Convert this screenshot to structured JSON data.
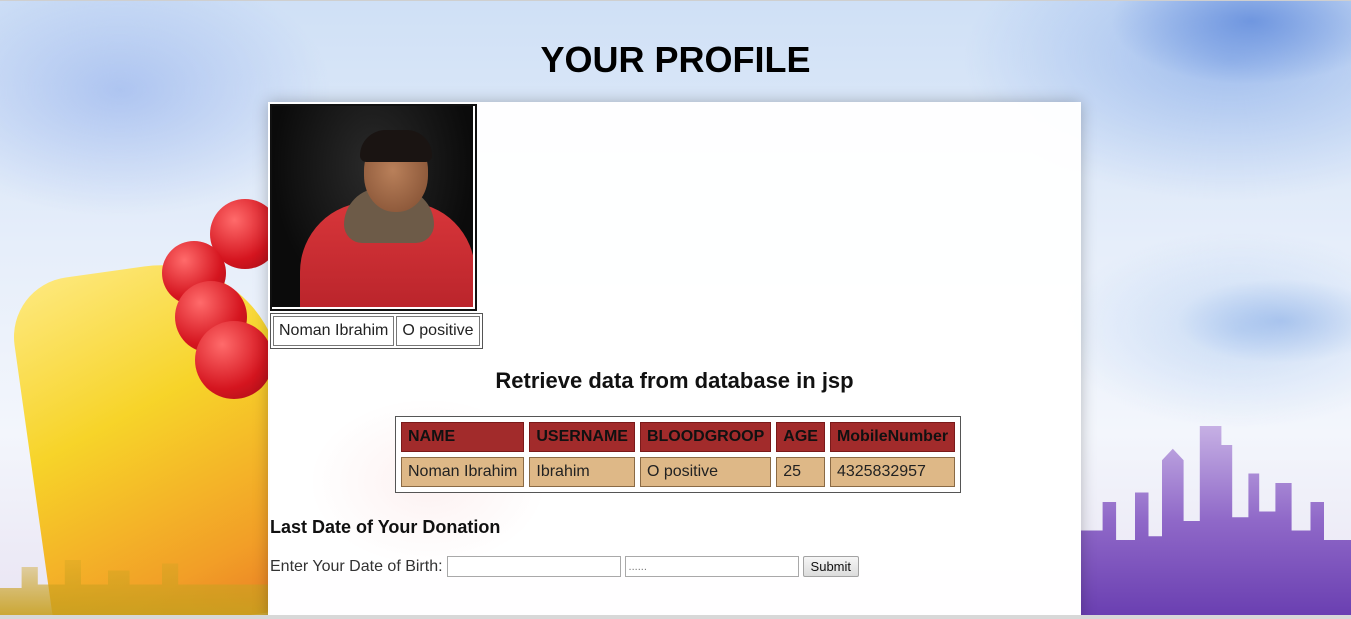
{
  "page": {
    "title": "YOUR PROFILE"
  },
  "profile": {
    "photo_icon": "user-photo",
    "name": "Noman Ibrahim",
    "blood_group": "O positive"
  },
  "records": {
    "heading": "Retrieve data from database in jsp",
    "columns": [
      "NAME",
      "USERNAME",
      "BLOODGROOP",
      "AGE",
      "MobileNumber"
    ],
    "rows": [
      [
        "Noman Ibrahim",
        "Ibrahim",
        "O positive",
        "25",
        "4325832957"
      ]
    ]
  },
  "donation": {
    "heading": "Last Date of Your Donation",
    "dob_label": "Enter Your Date of Birth:",
    "field1_value": "",
    "field2_placeholder": "......",
    "submit_label": "Submit"
  },
  "colors": {
    "header_cell": "#a22b2b",
    "data_cell": "#deb887"
  }
}
